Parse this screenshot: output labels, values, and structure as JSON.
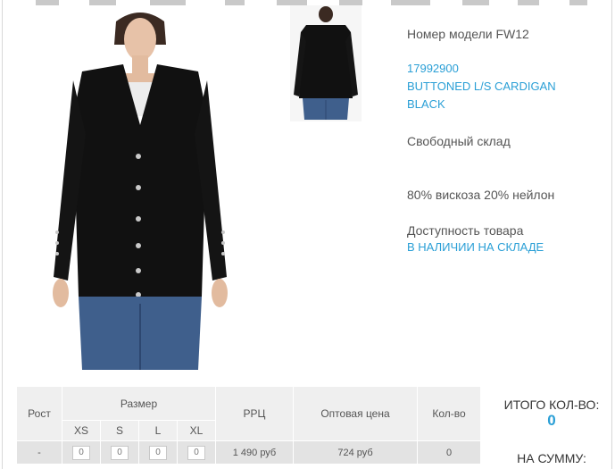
{
  "product": {
    "model_label": "Номер модели FW12",
    "sku": "17992900",
    "name_line1": "BUTTONED L/S CARDIGAN",
    "name_line2": "BLACK",
    "warehouse": "Свободный склад",
    "composition": "80% вискоза 20% нейлон",
    "availability_label": "Доступность товара",
    "availability_status": "В НАЛИЧИИ НА СКЛАДЕ"
  },
  "table": {
    "col_height": "Рост",
    "col_size": "Размер",
    "col_rrp": "РРЦ",
    "col_wholesale": "Оптовая цена",
    "col_qty": "Кол-во",
    "sizes": [
      "XS",
      "S",
      "L",
      "XL"
    ],
    "row": {
      "height": "-",
      "qty_values": [
        "0",
        "0",
        "0",
        "0"
      ],
      "rrp": "1 490 руб",
      "wholesale": "724 руб",
      "qty": "0"
    }
  },
  "totals": {
    "total_qty_label": "ИТОГО КОЛ-ВО:",
    "total_qty_value": "0",
    "total_sum_label": "НА СУММУ:"
  },
  "colors": {
    "link": "#2a9fd6",
    "garment": "#111111",
    "denim": "#3f5f8c"
  }
}
